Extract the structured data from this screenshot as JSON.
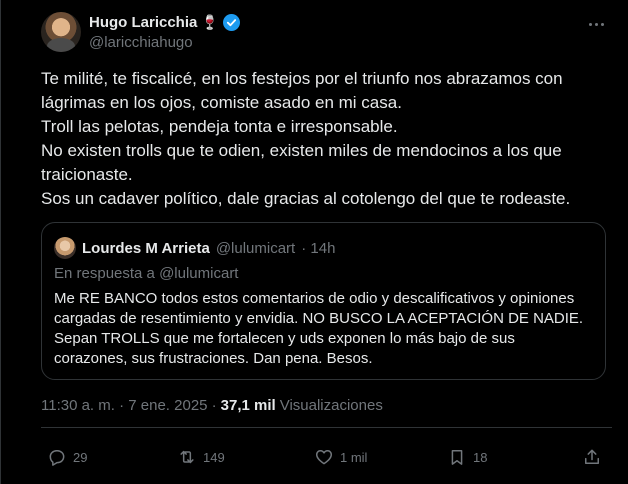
{
  "author": {
    "name": "Hugo Laricchia",
    "emoji": "🍷",
    "handle": "@laricchiahugo"
  },
  "tweet": {
    "lines": [
      "Te milité, te fiscalicé, en los festejos por el triunfo nos abrazamos con",
      "lágrimas en los ojos, comiste asado en mi casa.",
      "Troll las pelotas, pendeja tonta e irresponsable.",
      "No existen trolls que te odien, existen miles de mendocinos a los que",
      "traicionaste.",
      "Sos un cadaver político, dale gracias al cotolengo del que te rodeaste."
    ]
  },
  "quote": {
    "name": "Lourdes M Arrieta",
    "handle": "@lulumicart",
    "time": "· 14h",
    "reply_to": "En respuesta a @lulumicart",
    "lines": [
      "Me RE BANCO todos estos comentarios de odio y descalificativos y opiniones",
      "cargadas de resentimiento y envidia. NO BUSCO LA ACEPTACIÓN DE NADIE.",
      "Sepan TROLLS que me fortalecen y uds exponen lo más bajo de sus",
      "corazones, sus frustraciones. Dan pena. Besos."
    ]
  },
  "meta": {
    "time": "11:30 a. m. · 7 ene. 2025 ·",
    "views_count": "37,1 mil",
    "views_label": "Visualizaciones"
  },
  "actions": {
    "replies": "29",
    "reposts": "149",
    "likes": "1 mil",
    "bookmarks": "18"
  },
  "colors": {
    "background": "#000000",
    "text": "#e7e9ea",
    "muted": "#71767b",
    "border": "#2f3336",
    "verified": "#1d9bf0"
  }
}
